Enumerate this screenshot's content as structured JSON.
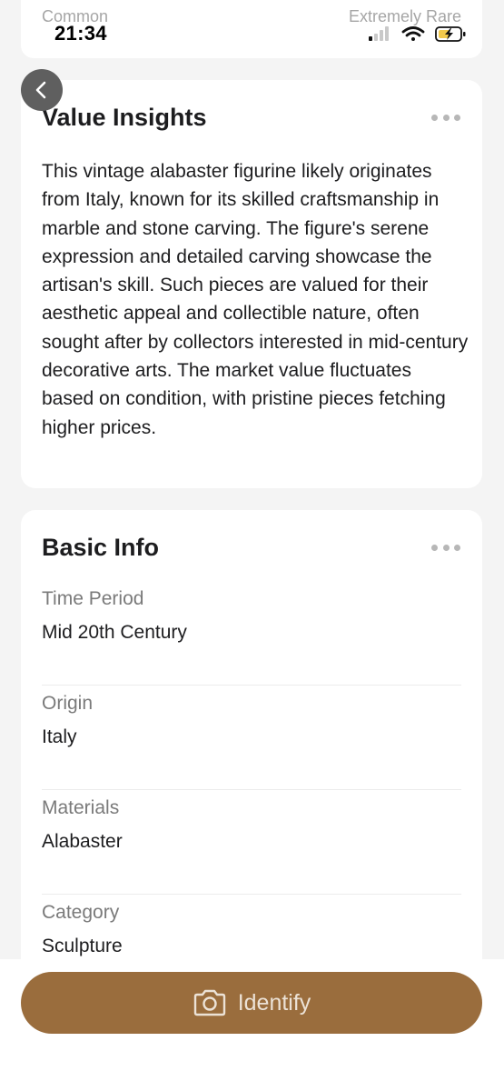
{
  "status_bar": {
    "time": "21:34",
    "icons": [
      "signal-icon",
      "wifi-icon",
      "battery-charging-icon"
    ]
  },
  "rarity_scale": {
    "low_label": "Common",
    "high_label": "Extremely Rare"
  },
  "value_insights": {
    "title": "Value Insights",
    "body": "This vintage alabaster figurine likely originates from Italy, known for its skilled craftsmanship in marble and stone carving. The figure's serene expression and detailed carving showcase the artisan's skill. Such pieces are valued for their aesthetic appeal and collectible nature, often sought after by collectors interested in mid-century decorative arts. The market value fluctuates based on condition, with pristine pieces fetching higher prices."
  },
  "basic_info": {
    "title": "Basic Info",
    "rows": [
      {
        "label": "Time Period",
        "value": "Mid 20th Century"
      },
      {
        "label": "Origin",
        "value": "Italy"
      },
      {
        "label": "Materials",
        "value": "Alabaster"
      },
      {
        "label": "Category",
        "value": "Sculpture"
      }
    ]
  },
  "actions": {
    "identify_label": "Identify",
    "identify_icon": "camera-icon",
    "back_icon": "chevron-left-icon",
    "more_icon": "more-dots-icon"
  },
  "colors": {
    "accent": "#9a6d3d",
    "button_text": "#ece2d6",
    "background": "#f4f4f4",
    "card": "#ffffff",
    "back_button": "#5f5f5f",
    "battery_charging": "#f2c94c"
  }
}
